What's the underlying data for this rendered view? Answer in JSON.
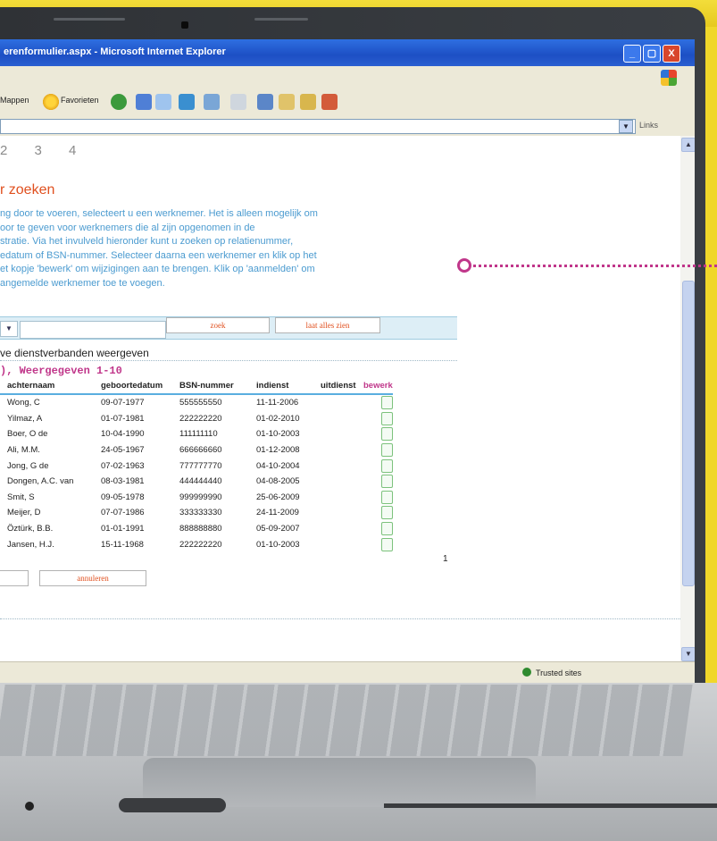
{
  "window": {
    "title": "erenformulier.aspx - Microsoft Internet Explorer",
    "min_glyph": "_",
    "max_glyph": "▢",
    "close_glyph": "X"
  },
  "toolbar": {
    "folders_label": "Mappen",
    "favorites_label": "Favorieten"
  },
  "addressbar": {
    "links_label": "Links"
  },
  "page": {
    "steps": [
      "2",
      "3",
      "4"
    ],
    "heading": "r zoeken",
    "intro_lines": [
      "ng door te voeren, selecteert u een werknemer. Het is alleen mogelijk om",
      "oor te geven voor werknemers die al zijn opgenomen in de",
      "stratie. Via het invulveld hieronder kunt u zoeken op relatienummer,",
      "edatum of BSN-nummer. Selecteer daarna een werknemer en klik op het",
      "et kopje 'bewerk' om wijzigingen aan te brengen. Klik op 'aanmelden' om",
      "angemelde werknemer toe te voegen."
    ],
    "search_input_value": "",
    "search_button": "zoek",
    "show_all_button": "laat alles zien",
    "toggle_text": "ve dienstverbanden weergeven",
    "count_text": "), Weergegeven 1-10",
    "columns": [
      "achternaam",
      "geboortedatum",
      "BSN-nummer",
      "indienst",
      "uitdienst",
      "bewerk"
    ],
    "rows": [
      [
        "Wong, C",
        "09-07-1977",
        "555555550",
        "11-11-2006",
        ""
      ],
      [
        "Yilmaz, A",
        "01-07-1981",
        "222222220",
        "01-02-2010",
        ""
      ],
      [
        "Boer, O de",
        "10-04-1990",
        "111111110",
        "01-10-2003",
        ""
      ],
      [
        "Ali, M.M.",
        "24-05-1967",
        "666666660",
        "01-12-2008",
        ""
      ],
      [
        "Jong, G de",
        "07-02-1963",
        "777777770",
        "04-10-2004",
        ""
      ],
      [
        "Dongen, A.C. van",
        "08-03-1981",
        "444444440",
        "04-08-2005",
        ""
      ],
      [
        "Smit, S",
        "09-05-1978",
        "999999990",
        "25-06-2009",
        ""
      ],
      [
        "Meijer, D",
        "07-07-1986",
        "333333330",
        "24-11-2009",
        ""
      ],
      [
        "Öztürk, B.B.",
        "01-01-1991",
        "888888880",
        "05-09-2007",
        ""
      ],
      [
        "Jansen, H.J.",
        "15-11-1968",
        "222222220",
        "01-10-2003",
        ""
      ]
    ],
    "page_number": "1",
    "cancel_button": "annuleren"
  },
  "statusbar": {
    "zone": "Trusted sites"
  },
  "colors": {
    "accent_orange": "#e0501f",
    "accent_magenta": "#c0368a",
    "intro_blue": "#4b9bd0",
    "xp_blue": "#2e6fe1"
  }
}
